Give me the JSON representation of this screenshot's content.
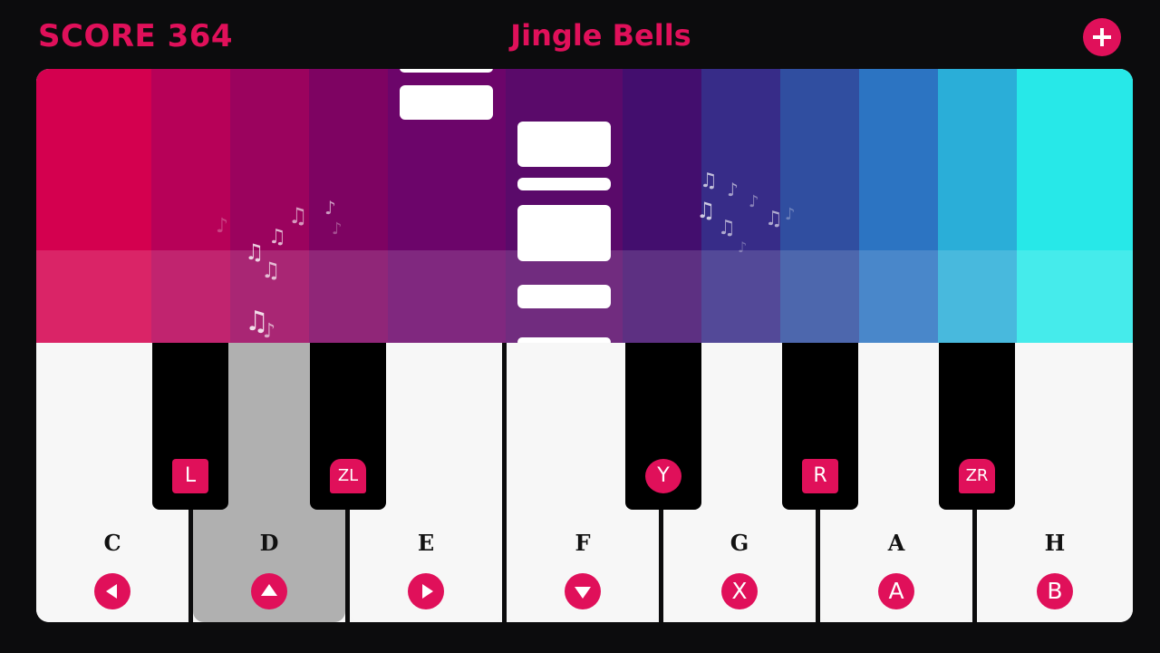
{
  "hud": {
    "score": "SCORE 364",
    "song_title": "Jingle Bells"
  },
  "lanes": [
    {
      "color": "#d4004f"
    },
    {
      "color": "#b70158"
    },
    {
      "color": "#9b035e"
    },
    {
      "color": "#7e0362"
    },
    {
      "color": "#6c056a"
    },
    {
      "color": "#5a0a6a"
    },
    {
      "color": "#430e6e"
    },
    {
      "color": "#372c88"
    },
    {
      "color": "#304ea0"
    },
    {
      "color": "#2c74c2"
    },
    {
      "color": "#2aaed8"
    },
    {
      "color": "#27e8e8"
    }
  ],
  "keys": {
    "white": [
      {
        "note": "C",
        "button": "◀",
        "button_icon": "left-arrow-button-icon",
        "pressed": false
      },
      {
        "note": "D",
        "button": "▲",
        "button_icon": "up-arrow-button-icon",
        "pressed": true
      },
      {
        "note": "E",
        "button": "▶",
        "button_icon": "right-arrow-button-icon",
        "pressed": false
      },
      {
        "note": "F",
        "button": "▼",
        "button_icon": "down-arrow-button-icon",
        "pressed": false
      },
      {
        "note": "G",
        "button": "X",
        "button_icon": "x-button-icon",
        "pressed": false
      },
      {
        "note": "A",
        "button": "A",
        "button_icon": "a-button-icon",
        "pressed": false
      },
      {
        "note": "H",
        "button": "B",
        "button_icon": "b-button-icon",
        "pressed": false
      }
    ],
    "black": [
      {
        "button": "L",
        "shape": "sq"
      },
      {
        "button": "ZL",
        "shape": "tab"
      },
      {
        "button": "Y",
        "shape": "circle"
      },
      {
        "button": "R",
        "shape": "sq"
      },
      {
        "button": "ZR",
        "shape": "tab"
      }
    ]
  },
  "theme": {
    "accent": "#e0105a",
    "background": "#0c0c0d",
    "white_key": "#f7f7f7",
    "pressed_key": "#b0b0b0",
    "black_key": "#000000"
  }
}
